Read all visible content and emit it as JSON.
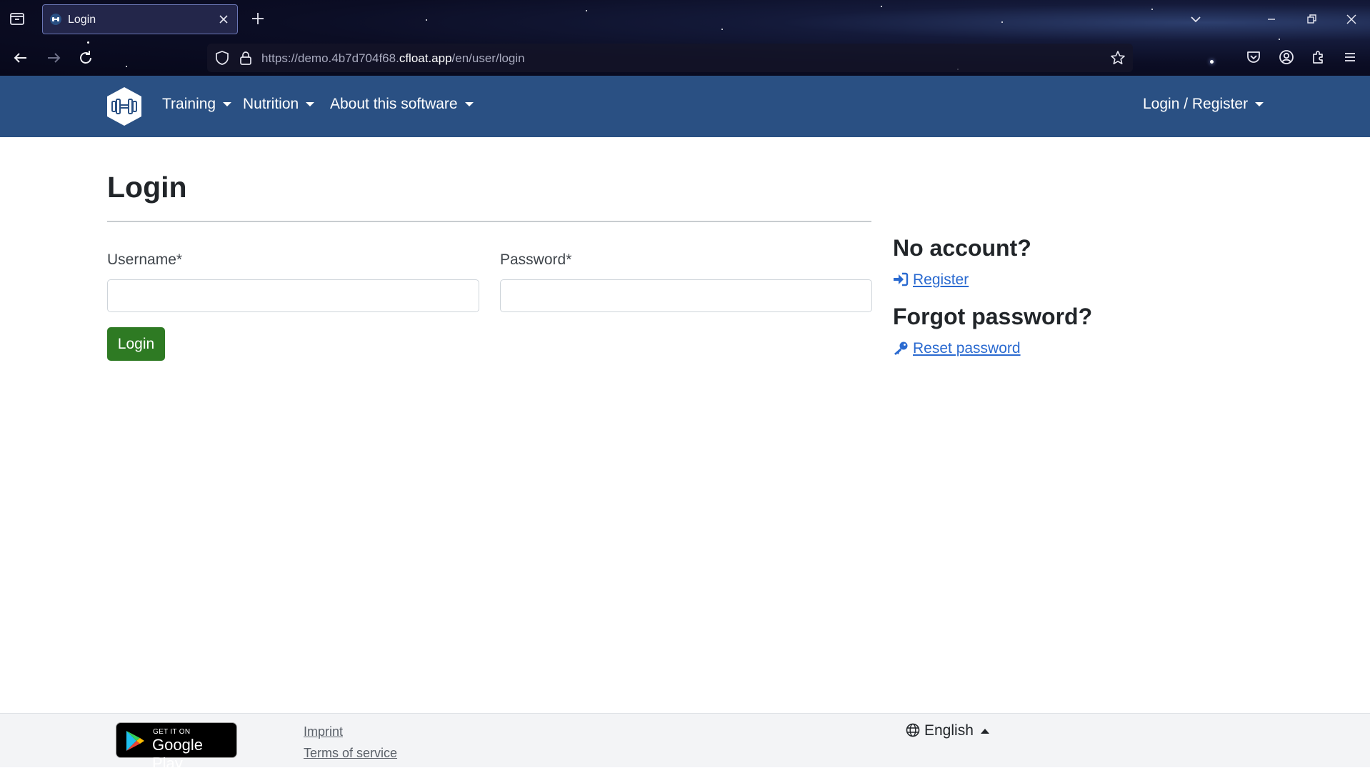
{
  "browser": {
    "tab_title": "Login",
    "url_prefix": "https://demo.4b7d704f68.",
    "url_host": "cfloat.app",
    "url_path": "/en/user/login"
  },
  "navbar": {
    "items": [
      {
        "label": "Training"
      },
      {
        "label": "Nutrition"
      },
      {
        "label": "About this software"
      }
    ],
    "account_label": "Login / Register",
    "brand_color": "#2a5083"
  },
  "main": {
    "title": "Login",
    "username_label": "Username*",
    "username_value": "",
    "password_label": "Password*",
    "password_value": "",
    "submit_label": "Login",
    "submit_color": "#2e7a23"
  },
  "sidebar": {
    "no_account_heading": "No account?",
    "register_label": "Register",
    "forgot_heading": "Forgot password?",
    "reset_label": "Reset password",
    "link_color": "#2a6ad0"
  },
  "footer": {
    "gplay_small": "GET IT ON",
    "gplay_big": "Google Play",
    "imprint_label": "Imprint",
    "terms_label": "Terms of service",
    "language_label": "English"
  }
}
